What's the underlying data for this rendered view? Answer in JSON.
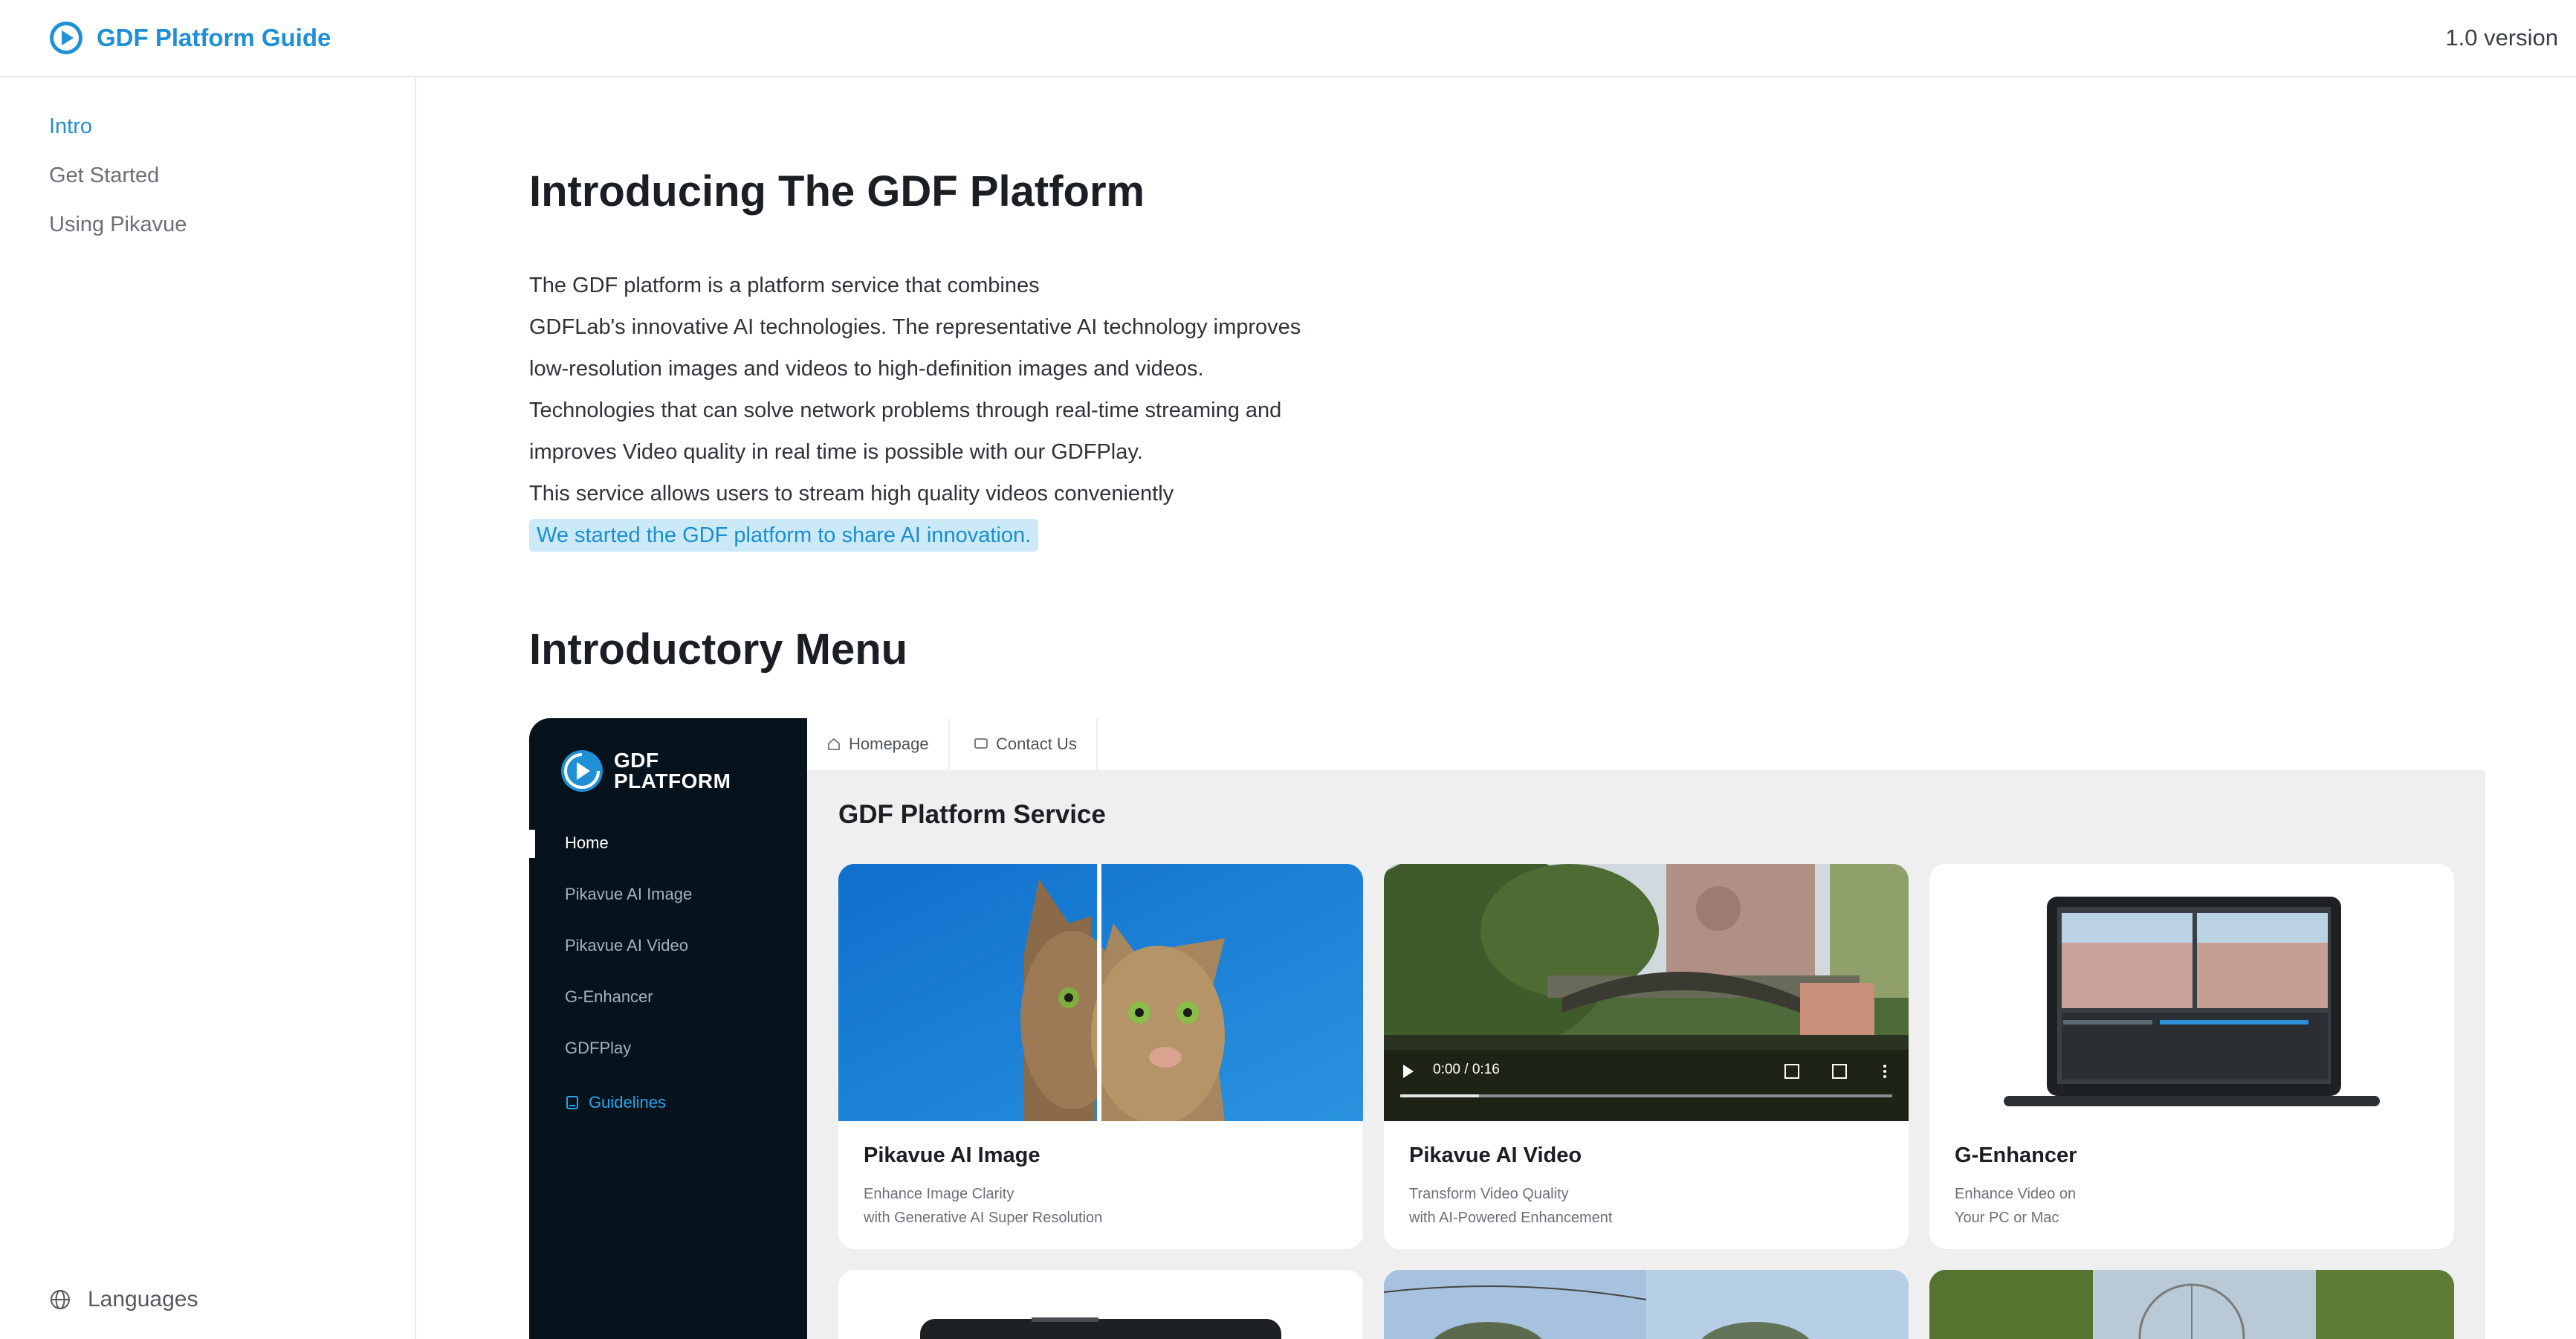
{
  "header": {
    "title": "GDF Platform Guide",
    "version": "1.0 version",
    "brand_color": "#1f8fd6"
  },
  "sidebar": {
    "items": [
      {
        "label": "Intro",
        "active": true
      },
      {
        "label": "Get Started",
        "active": false
      },
      {
        "label": "Using Pikavue",
        "active": false
      }
    ],
    "languages_label": "Languages"
  },
  "main": {
    "title": "Introducing The GDF Platform",
    "paragraph_lines": [
      "The GDF platform is a platform service that combines",
      "GDFLab's innovative AI technologies. The representative AI technology improves",
      "low-resolution images and videos to high-definition images and videos.",
      "Technologies that can solve network problems through real-time streaming and",
      "improves Video quality in real time is possible with our GDFPlay.",
      "This service allows users to stream high quality videos conveniently"
    ],
    "highlight": "We started the GDF platform to share AI innovation.",
    "menu_title": "Introductory Menu"
  },
  "embed": {
    "logo_line1": "GDF",
    "logo_line2": "PLATFORM",
    "nav": [
      {
        "label": "Home",
        "active": true
      },
      {
        "label": "Pikavue AI Image",
        "active": false
      },
      {
        "label": "Pikavue AI Video",
        "active": false
      },
      {
        "label": "G-Enhancer",
        "active": false
      },
      {
        "label": "GDFPlay",
        "active": false
      }
    ],
    "guidelines": "Guidelines",
    "tabs": [
      {
        "label": "Homepage",
        "icon": "home-icon"
      },
      {
        "label": "Contact Us",
        "icon": "chat-icon"
      }
    ],
    "service_title": "GDF Platform Service",
    "cards": [
      {
        "title": "Pikavue AI Image",
        "desc1": "Enhance Image Clarity",
        "desc2": "with Generative AI Super Resolution"
      },
      {
        "title": "Pikavue AI Video",
        "desc1": "Transform Video Quality",
        "desc2": "with AI-Powered Enhancement"
      },
      {
        "title": "G-Enhancer",
        "desc1": "Enhance Video on",
        "desc2": "Your PC or Mac"
      }
    ],
    "video_time": "0:00 / 0:16"
  }
}
